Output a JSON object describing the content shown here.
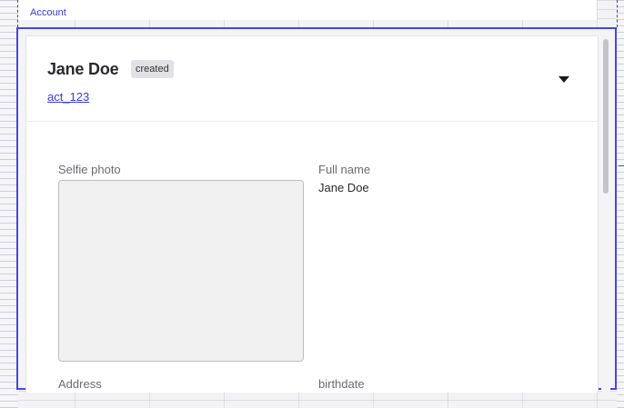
{
  "account_section": {
    "label": "Account"
  },
  "card": {
    "name": "Jane Doe",
    "status": "created",
    "account_id": "act_123",
    "fields": {
      "selfie_label": "Selfie photo",
      "full_name_label": "Full name",
      "full_name_value": "Jane Doe",
      "address_label": "Address",
      "birthdate_label": "birthdate"
    }
  },
  "icons": {
    "collapse": "caret-down-icon"
  },
  "colors": {
    "accent": "#4646e6",
    "link": "#3a3ae0",
    "badge_bg": "#e2e2e6",
    "photo_placeholder": "#f0f0f0"
  }
}
